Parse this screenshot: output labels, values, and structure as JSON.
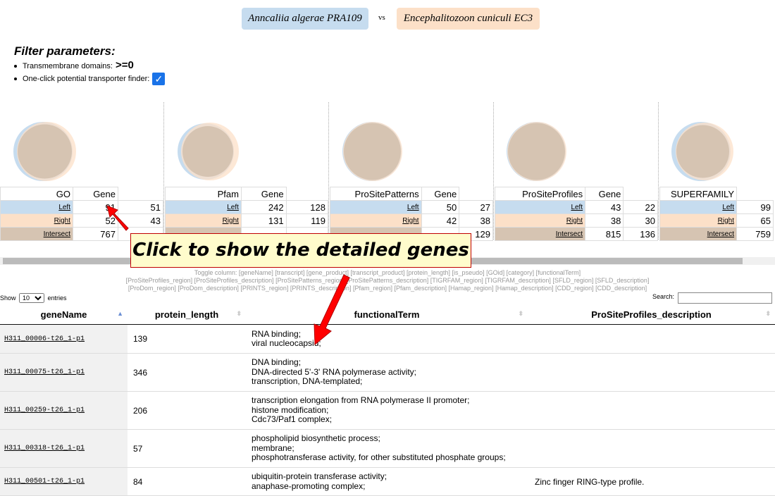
{
  "header": {
    "left_species": "Anncaliia algerae PRA109",
    "vs": "vs",
    "right_species": "Encephalitozoon cuniculi EC3"
  },
  "filters": {
    "title": "Filter parameters:",
    "tm_label": "Transmembrane domains:",
    "tm_value": ">=0",
    "transporter_label": "One-click potential transporter finder:",
    "transporter_checked": true
  },
  "colors": {
    "left": "#c6dcef",
    "right": "#fce0c8",
    "intersect": "#d6c4b2"
  },
  "panels": [
    {
      "name": "GO",
      "gene_header": "Gene",
      "rows": [
        {
          "label": "Left",
          "value": "91",
          "gene": "51"
        },
        {
          "label": "Right",
          "value": "52",
          "gene": "43"
        },
        {
          "label": "Intersect",
          "value": "767",
          "gene": ""
        }
      ]
    },
    {
      "name": "Pfam",
      "gene_header": "Gene",
      "rows": [
        {
          "label": "Left",
          "value": "242",
          "gene": "128"
        },
        {
          "label": "Right",
          "value": "131",
          "gene": "119"
        },
        {
          "label": "",
          "value": "",
          "gene": ""
        }
      ]
    },
    {
      "name": "ProSitePatterns",
      "gene_header": "Gene",
      "rows": [
        {
          "label": "Left",
          "value": "50",
          "gene": "27"
        },
        {
          "label": "Right",
          "value": "42",
          "gene": "38"
        },
        {
          "label": "",
          "value": "",
          "gene": "129"
        }
      ]
    },
    {
      "name": "ProSiteProfiles",
      "gene_header": "Gene",
      "rows": [
        {
          "label": "Left",
          "value": "43",
          "gene": "22"
        },
        {
          "label": "Right",
          "value": "38",
          "gene": "30"
        },
        {
          "label": "Intersect",
          "value": "815",
          "gene": "136"
        }
      ]
    },
    {
      "name": "SUPERFAMILY",
      "gene_header": "",
      "rows": [
        {
          "label": "Left",
          "value": "99",
          "gene": ""
        },
        {
          "label": "Right",
          "value": "65",
          "gene": ""
        },
        {
          "label": "Intersect",
          "value": "759",
          "gene": ""
        }
      ]
    }
  ],
  "toggle": {
    "line1": "Toggle column: [geneName] [transcript] [gene_product] [transcript_product] [protein_length] [is_pseudo] [GOid] [category] [functionalTerm]",
    "line2": "[ProSiteProfiles_region] [ProSiteProfiles_description] [ProSitePatterns_region] [ProSitePatterns_description] [TIGRFAM_region] [TIGRFAM_description] [SFLD_region] [SFLD_description]",
    "line3": "[ProDom_region] [ProDom_description] [PRINTS_region] [PRINTS_description] [Pfam_region] [Pfam_description] [Hamap_region] [Hamap_description] [CDD_region] [CDD_description]"
  },
  "table_controls": {
    "show": "Show",
    "entries_value": "10",
    "entries": "entries",
    "search": "Search:"
  },
  "columns": [
    "geneName",
    "protein_length",
    "functionalTerm",
    "ProSiteProfiles_description"
  ],
  "rows": [
    {
      "gene": "H311_00006-t26_1-p1",
      "length": "139",
      "terms": [
        "RNA binding;",
        "viral nucleocapsid;"
      ],
      "desc": ""
    },
    {
      "gene": "H311_00075-t26_1-p1",
      "length": "346",
      "terms": [
        "DNA binding;",
        "DNA-directed 5'-3' RNA polymerase activity;",
        "transcription, DNA-templated;"
      ],
      "desc": ""
    },
    {
      "gene": "H311_00259-t26_1-p1",
      "length": "206",
      "terms": [
        "transcription elongation from RNA polymerase II promoter;",
        "histone modification;",
        "Cdc73/Paf1 complex;"
      ],
      "desc": ""
    },
    {
      "gene": "H311_00318-t26_1-p1",
      "length": "57",
      "terms": [
        "phospholipid biosynthetic process;",
        "membrane;",
        "phosphotransferase activity, for other substituted phosphate groups;"
      ],
      "desc": ""
    },
    {
      "gene": "H311_00501-t26_1-p1",
      "length": "84",
      "terms": [
        "ubiquitin-protein transferase activity;",
        "anaphase-promoting complex;"
      ],
      "desc": "Zinc finger RING-type profile."
    }
  ],
  "callout": "Click to show the detailed genes"
}
